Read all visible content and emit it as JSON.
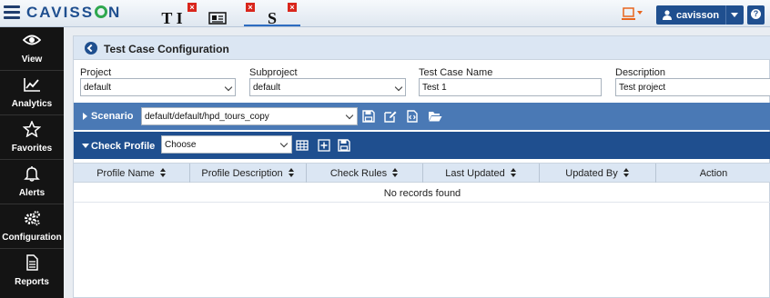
{
  "app": {
    "logo_text_left": "CAVISS",
    "logo_text_right": "N"
  },
  "tabs": [
    {
      "glyph": "T I",
      "icon": "text-tool-icon",
      "close": "×"
    },
    {
      "glyph": "",
      "icon": "newspaper-icon",
      "close": "×"
    },
    {
      "glyph": "S",
      "icon": "script-icon",
      "close": "×"
    }
  ],
  "user": {
    "name": "cavisson"
  },
  "help_label": "?",
  "sidebar": {
    "items": [
      {
        "label": "View",
        "icon": "eye-icon"
      },
      {
        "label": "Analytics",
        "icon": "line-chart-icon"
      },
      {
        "label": "Favorites",
        "icon": "star-icon"
      },
      {
        "label": "Alerts",
        "icon": "bell-icon"
      },
      {
        "label": "Configuration",
        "icon": "gears-icon"
      },
      {
        "label": "Reports",
        "icon": "document-icon"
      }
    ]
  },
  "panel": {
    "title": "Test Case Configuration"
  },
  "form": {
    "project": {
      "label": "Project",
      "value": "default"
    },
    "subproject": {
      "label": "Subproject",
      "value": "default"
    },
    "test_case_name": {
      "label": "Test Case Name",
      "value": "Test 1"
    },
    "description": {
      "label": "Description",
      "value": "Test project"
    }
  },
  "scenario": {
    "label": "Scenario",
    "value": "default/default/hpd_tours_copy"
  },
  "check_profile": {
    "label": "Check Profile",
    "value": "Choose"
  },
  "table": {
    "columns": [
      "Profile Name",
      "Profile Description",
      "Check Rules",
      "Last Updated",
      "Updated By",
      "Action"
    ],
    "empty_message": "No records found"
  },
  "colors": {
    "brand": "#1f4f8f",
    "accent_green": "#2fa84f",
    "scenario_bar": "#4a79b5",
    "close_red": "#d9261c"
  }
}
